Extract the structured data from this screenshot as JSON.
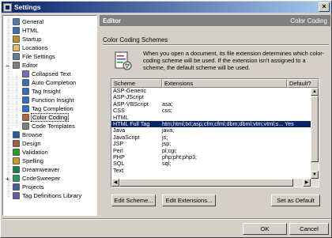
{
  "window": {
    "title": "Settings",
    "close_glyph": "×"
  },
  "tree": {
    "items": [
      {
        "label": "General",
        "icon": "general-icon",
        "color": "#4a7ab5"
      },
      {
        "label": "HTML",
        "icon": "html-icon",
        "color": "#3b6fb0"
      },
      {
        "label": "Startup",
        "icon": "startup-icon",
        "color": "#c09020"
      },
      {
        "label": "Locations",
        "icon": "folder-icon",
        "color": "#e0c060"
      },
      {
        "label": "File Settings",
        "icon": "file-settings-icon",
        "color": "#6080a0"
      },
      {
        "label": "Editor",
        "icon": "editor-icon",
        "color": "#808080"
      },
      {
        "label": "Collapsed Text",
        "icon": "collapsed-text-icon",
        "color": "#7070c0"
      },
      {
        "label": "Auto Completion",
        "icon": "auto-completion-icon",
        "color": "#3070c0"
      },
      {
        "label": "Tag Insight",
        "icon": "tag-insight-icon",
        "color": "#3070c0"
      },
      {
        "label": "Function Insight",
        "icon": "function-insight-icon",
        "color": "#3070c0"
      },
      {
        "label": "Tag Completion",
        "icon": "tag-completion-icon",
        "color": "#3070c0"
      },
      {
        "label": "Color Coding",
        "icon": "color-coding-icon",
        "color": "#c06030"
      },
      {
        "label": "Code Templates",
        "icon": "code-templates-icon",
        "color": "#808080"
      },
      {
        "label": "Browse",
        "icon": "browse-icon",
        "color": "#2060a0"
      },
      {
        "label": "Design",
        "icon": "design-icon",
        "color": "#a06040"
      },
      {
        "label": "Validation",
        "icon": "validation-icon",
        "color": "#20a020"
      },
      {
        "label": "Spelling",
        "icon": "spelling-icon",
        "color": "#c0a020"
      },
      {
        "label": "Dreamweaver",
        "icon": "dreamweaver-icon",
        "color": "#208040"
      },
      {
        "label": "CodeSweeper",
        "icon": "codesweeper-icon",
        "color": "#20a060"
      },
      {
        "label": "Projects",
        "icon": "projects-icon",
        "color": "#4060a0"
      },
      {
        "label": "Tag Definitions Library",
        "icon": "tag-library-icon",
        "color": "#6060a0"
      }
    ]
  },
  "header": {
    "title": "Editor",
    "section": "Color Coding"
  },
  "content": {
    "section_title": "Color Coding Schemes",
    "description": "When you open a document, its file extension determines which color-coding scheme will be used.  If the extension isn't assigned to a scheme, the default scheme will be used."
  },
  "list": {
    "columns": [
      "Scheme",
      "Extensions",
      "Default?"
    ],
    "rows": [
      [
        "ASP-Generic",
        "",
        ""
      ],
      [
        "ASP-JScript",
        "",
        ""
      ],
      [
        "ASP-VBScript",
        "asa;",
        ""
      ],
      [
        "CSS",
        "css;",
        ""
      ],
      [
        "HTML",
        "",
        ""
      ],
      [
        "HTML Full Tag",
        "htm;html;txt;asp;cfm;cfml;dbm;dbml;vtm;vtml;s...",
        "Yes"
      ],
      [
        "Java",
        "java;",
        ""
      ],
      [
        "JavaScript",
        "js;",
        ""
      ],
      [
        "JSP",
        "jsp;",
        ""
      ],
      [
        "Perl",
        "pl;cgi;",
        ""
      ],
      [
        "PHP",
        "php;pht;php3;",
        ""
      ],
      [
        "SQL",
        "sql;",
        ""
      ],
      [
        "Text",
        "",
        ""
      ]
    ],
    "selected_index": 5
  },
  "buttons": {
    "edit_scheme": "Edit Scheme...",
    "edit_extensions": "Edit Extensions...",
    "set_default": "Set as Default",
    "ok": "OK",
    "cancel": "Cancel"
  },
  "colors": {
    "title_start": "#0a246a",
    "title_end": "#a6caf0",
    "selection": "#0a246a",
    "header_bg": "#808080"
  }
}
